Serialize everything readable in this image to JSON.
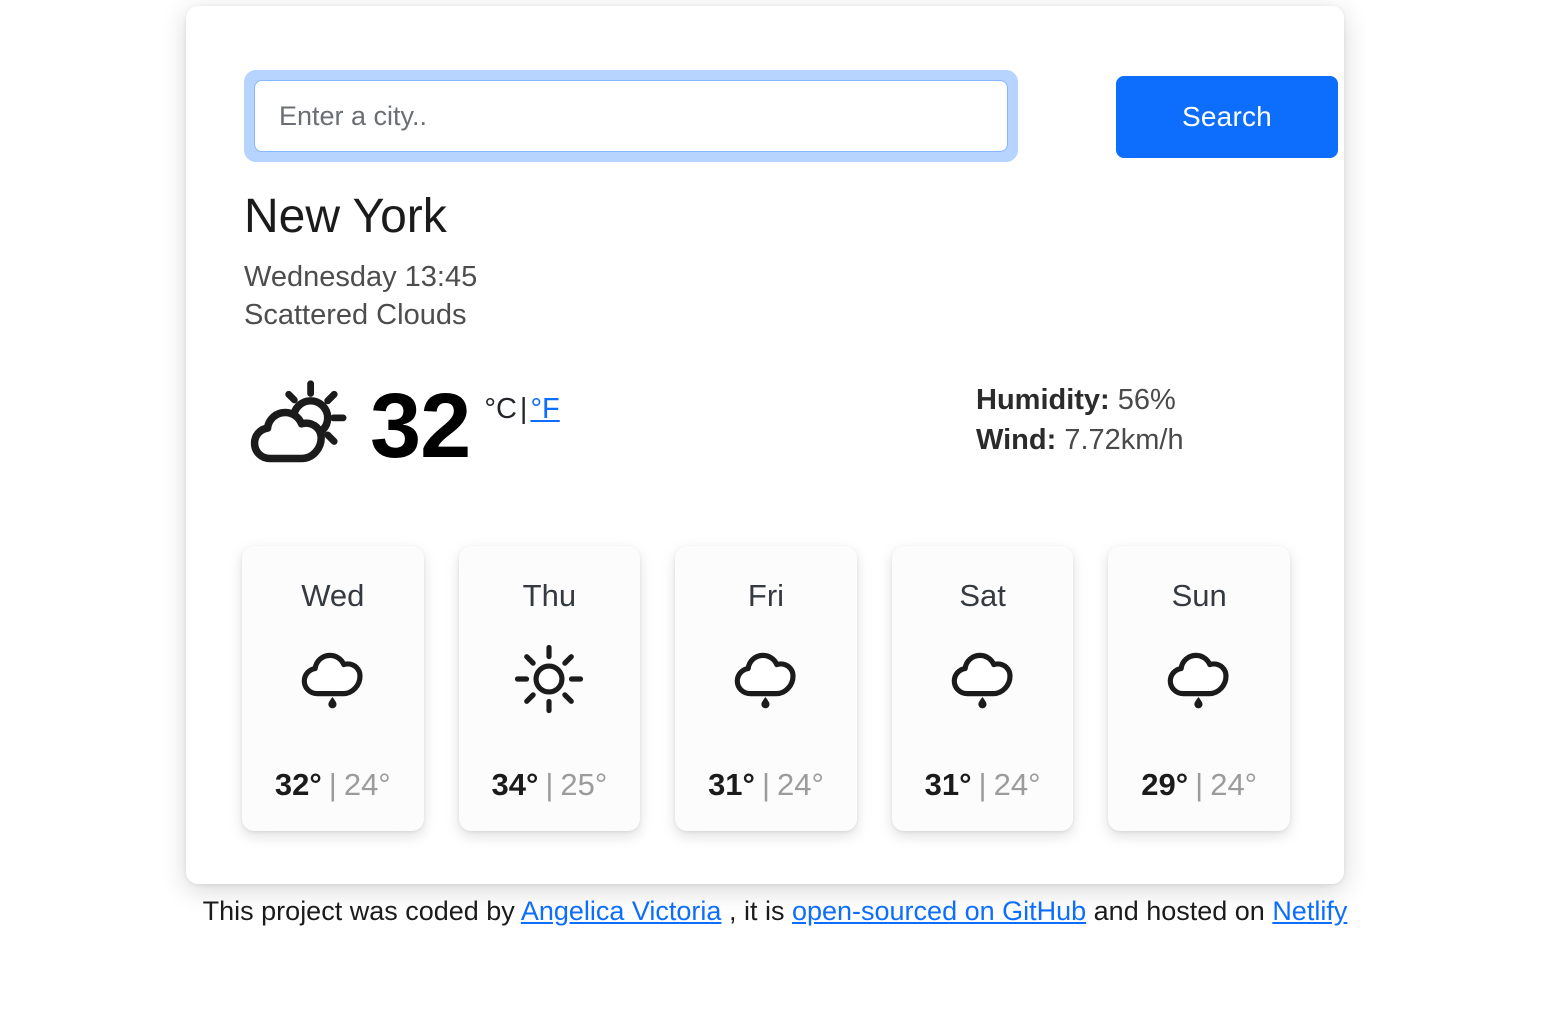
{
  "search": {
    "placeholder": "Enter a city..",
    "value": "",
    "button_label": "Search"
  },
  "current": {
    "city": "New York",
    "datetime": "Wednesday 13:45",
    "description": "Scattered Clouds",
    "icon": "cloud-sun-icon",
    "temperature": "32",
    "unit_celsius_label": "°C",
    "unit_separator": "|",
    "unit_fahrenheit_label": "°F",
    "humidity_label": "Humidity:",
    "humidity_value": "56%",
    "wind_label": "Wind:",
    "wind_value": "7.72km/h"
  },
  "forecast": [
    {
      "day": "Wed",
      "icon": "rain-cloud-icon",
      "max": "32°",
      "sep": "|",
      "min": "24°"
    },
    {
      "day": "Thu",
      "icon": "sun-icon",
      "max": "34°",
      "sep": "|",
      "min": "25°"
    },
    {
      "day": "Fri",
      "icon": "rain-cloud-icon",
      "max": "31°",
      "sep": "|",
      "min": "24°"
    },
    {
      "day": "Sat",
      "icon": "rain-cloud-icon",
      "max": "31°",
      "sep": "|",
      "min": "24°"
    },
    {
      "day": "Sun",
      "icon": "rain-cloud-icon",
      "max": "29°",
      "sep": "|",
      "min": "24°"
    }
  ],
  "footer": {
    "text_1": "This project was coded by ",
    "link_author": "Angelica Victoria",
    "text_2": " , it is ",
    "link_source": "open-sourced on GitHub",
    "text_3": " and hosted on ",
    "link_host": "Netlify"
  },
  "colors": {
    "accent": "#0d6efd",
    "focus_ring": "#b6d4fe",
    "text": "#1b1b1b",
    "muted": "#9b9b9b"
  }
}
